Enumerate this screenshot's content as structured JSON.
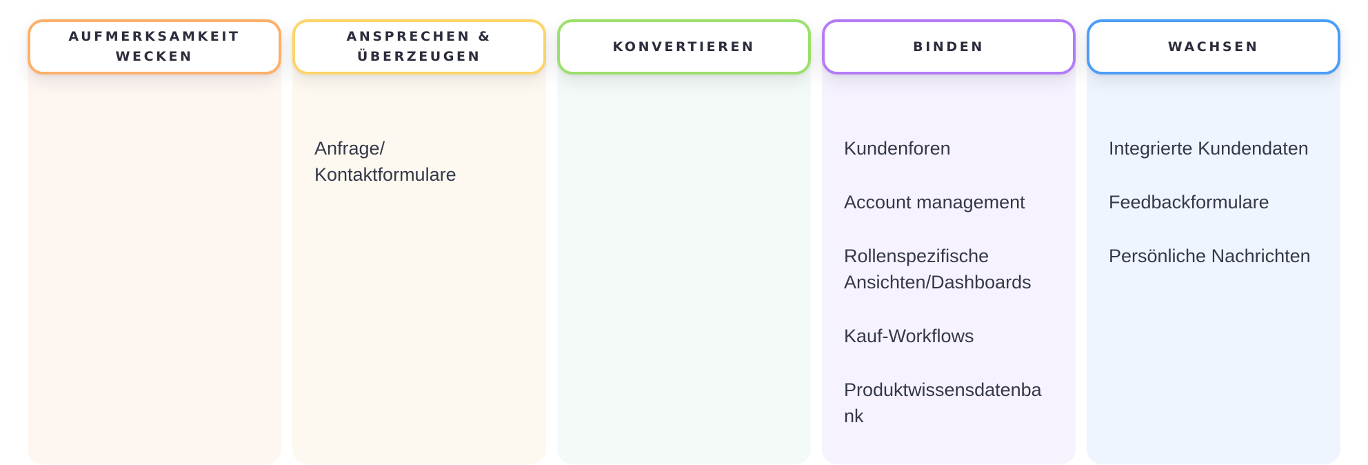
{
  "columns": [
    {
      "id": "awareness",
      "title": "Aufmerksamkeit wecken",
      "accent": "#FDB06A",
      "background": "#FEF6F1",
      "items": []
    },
    {
      "id": "engage",
      "title": "Ansprechen & Überzeugen",
      "accent": "#FDD468",
      "background": "#FEF9F0",
      "items": [
        "Anfrage/Kontaktformulare"
      ]
    },
    {
      "id": "convert",
      "title": "Konvertieren",
      "accent": "#9BE06A",
      "background": "#F3FAF7",
      "items": []
    },
    {
      "id": "retain",
      "title": "Binden",
      "accent": "#B47CF8",
      "background": "#F6F3FE",
      "items": [
        "Kundenforen",
        "Account management",
        "Rollenspezifische Ansichten/Dashboards",
        "Kauf-Workflows",
        "Produktwissensdatenbank"
      ]
    },
    {
      "id": "grow",
      "title": "Wachsen",
      "accent": "#4C9EF8",
      "background": "#EFF5FE",
      "items": [
        "Integrierte Kundendaten",
        "Feedbackformulare",
        "Persönliche Nachrichten"
      ]
    }
  ]
}
